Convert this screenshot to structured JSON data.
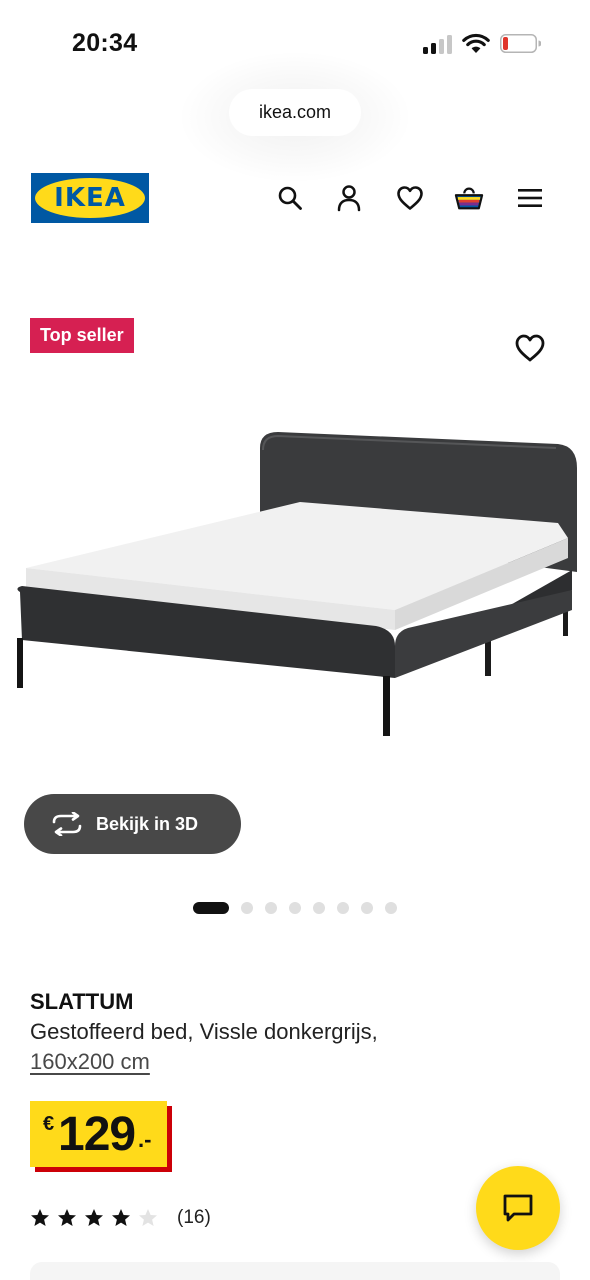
{
  "status_bar": {
    "time": "20:34"
  },
  "browser": {
    "url": "ikea.com"
  },
  "header": {
    "logo_text": "IKEA",
    "icons": [
      "search-icon",
      "account-icon",
      "wishlist-icon",
      "cart-icon",
      "menu-icon"
    ]
  },
  "product": {
    "badge": "Top seller",
    "view_3d_label": "Bekijk in 3D",
    "gallery": {
      "image_count": 8,
      "active_index": 0
    },
    "name": "SLATTUM",
    "description": "Gestoffeerd bed, Vissle donkergrijs,",
    "size": "160x200 cm",
    "price": {
      "currency": "€",
      "integer": "129",
      "decimal": ".-"
    },
    "rating": {
      "stars": 4,
      "max": 5,
      "count": "(16)"
    }
  },
  "colors": {
    "ikea_blue": "#0058a3",
    "ikea_yellow": "#ffda1a",
    "badge_red": "#d62052",
    "price_shadow": "#cc0008"
  }
}
